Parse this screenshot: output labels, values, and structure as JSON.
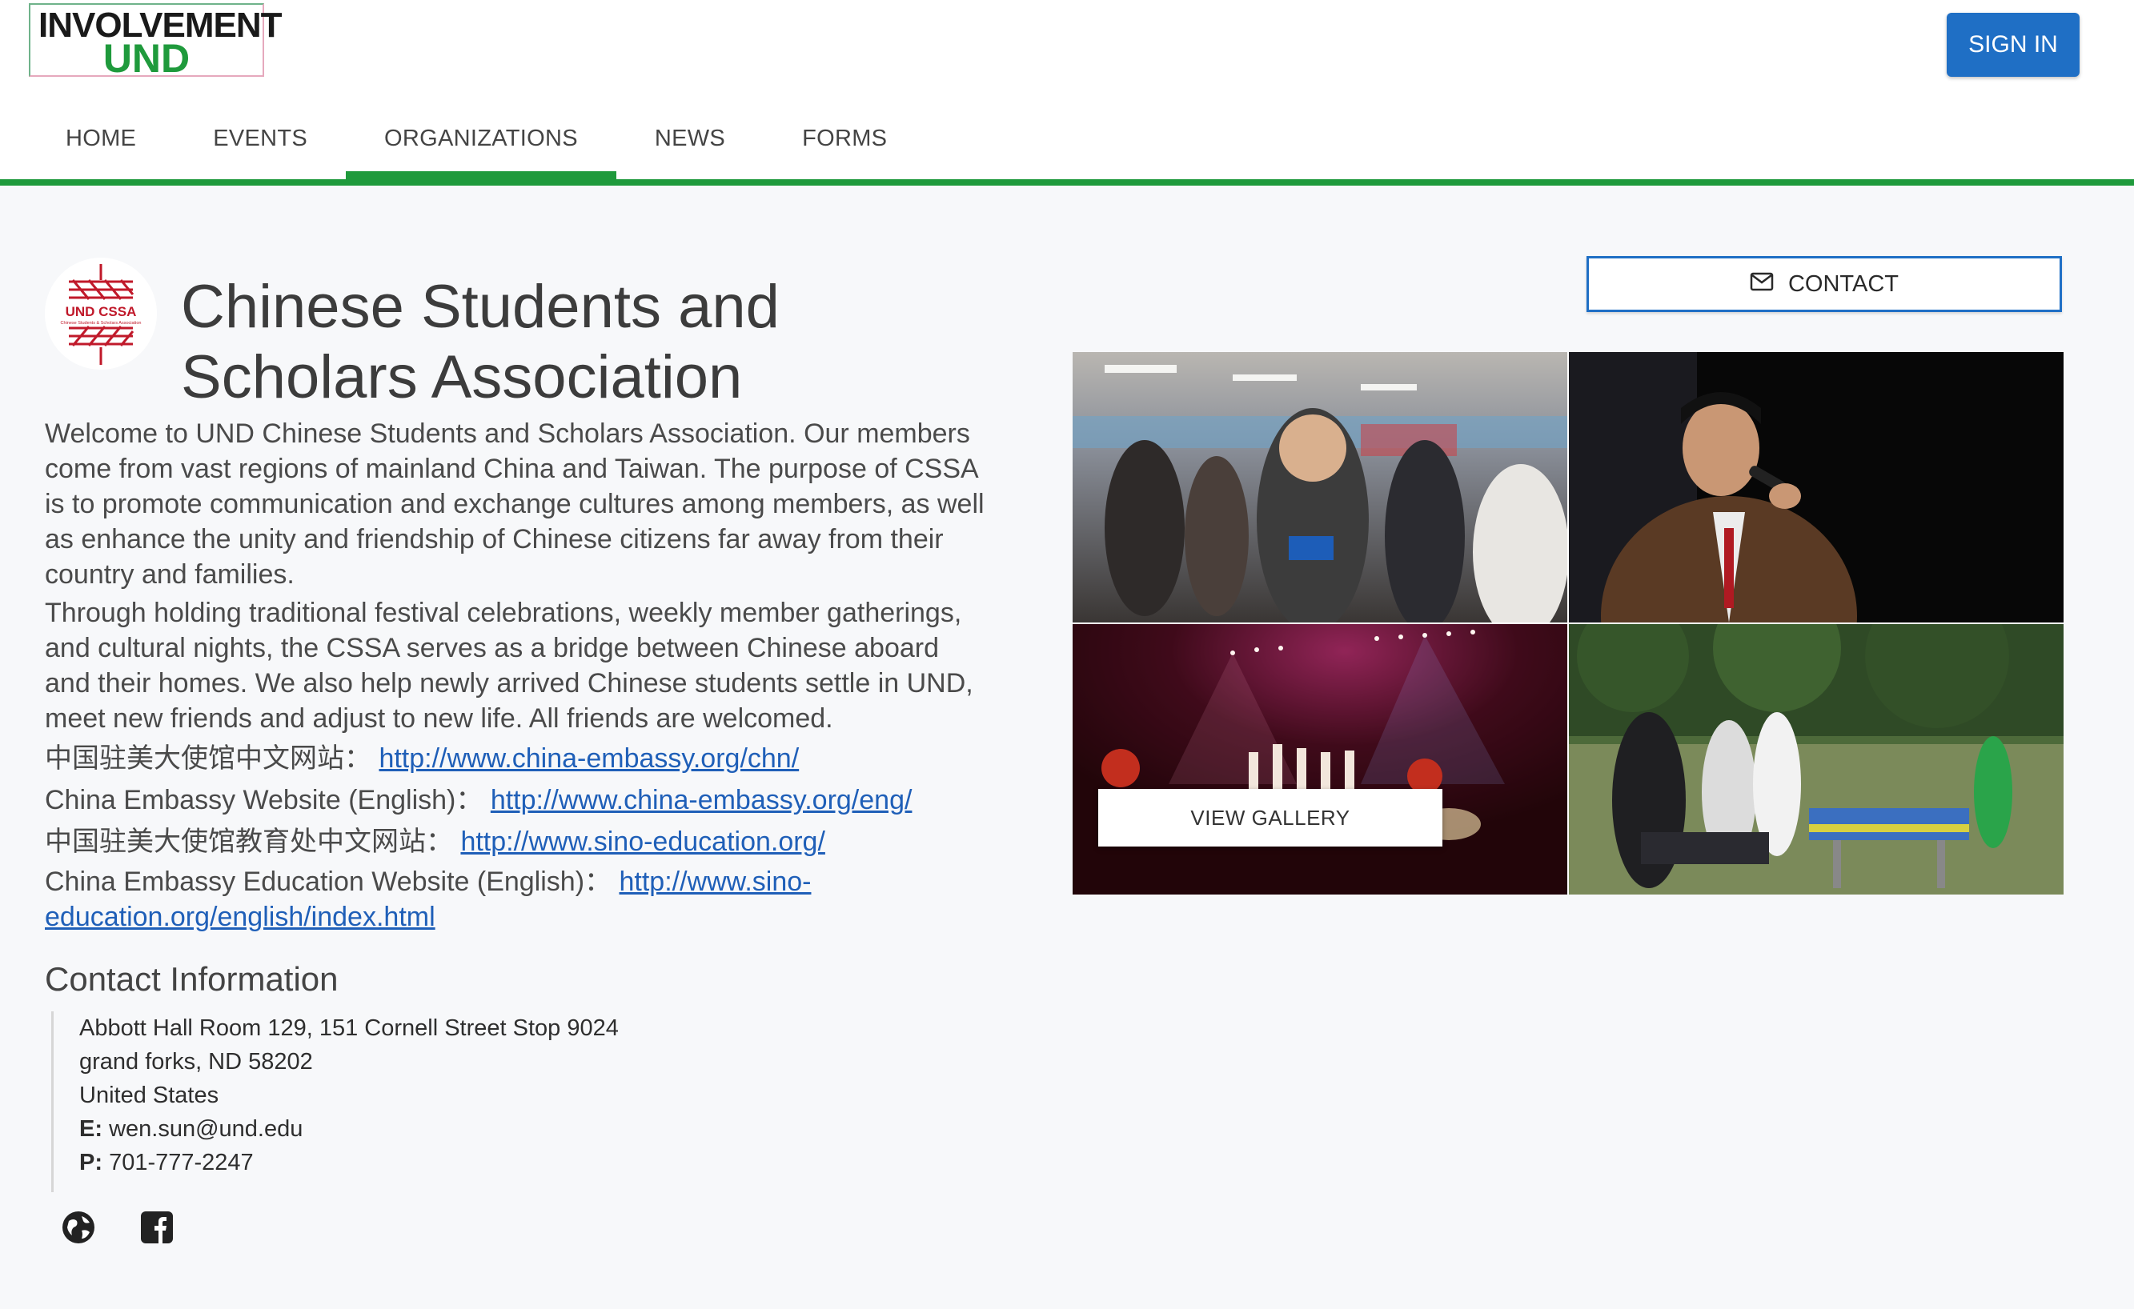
{
  "header": {
    "logo_line1": "INVOLVEMENT",
    "logo_line2": "UND",
    "signin_label": "SIGN IN"
  },
  "nav": {
    "tabs": [
      {
        "label": "HOME",
        "active": false
      },
      {
        "label": "EVENTS",
        "active": false
      },
      {
        "label": "ORGANIZATIONS",
        "active": true
      },
      {
        "label": "NEWS",
        "active": false
      },
      {
        "label": "FORMS",
        "active": false
      }
    ]
  },
  "colors": {
    "brand_green": "#1f9a3c",
    "primary_blue": "#1f6fc5",
    "link_blue": "#1f5fb8"
  },
  "organization": {
    "logo_text_1": "UND CSSA",
    "logo_text_2": "Chinese Students & Scholars Association",
    "name": "Chinese Students and Scholars Association",
    "description_p1": "Welcome to UND Chinese Students and Scholars Association. Our members come from vast regions of mainland China and Taiwan.  The purpose of CSSA is to promote communication and exchange cultures among members, as well as enhance the unity and friendship of Chinese citizens far away from their country and families.",
    "description_p2": "Through holding traditional festival celebrations, weekly member gatherings, and cultural nights, the CSSA serves as a bridge between Chinese aboard and their homes.  We also help newly arrived Chinese students settle in UND, meet new friends and adjust to new life.  All friends are welcomed.",
    "links": [
      {
        "label": "中国驻美大使馆中文网站：",
        "url": "http://www.china-embassy.org/chn/"
      },
      {
        "label": "China Embassy Website (English)：",
        "url": "http://www.china-embassy.org/eng/"
      },
      {
        "label": "中国驻美大使馆教育处中文网站：",
        "url": "http://www.sino-education.org/"
      },
      {
        "label": "China Embassy Education Website (English)：",
        "url": "http://www.sino-education.org/english/index.html"
      }
    ]
  },
  "contact": {
    "heading": "Contact Information",
    "address_line1": "Abbott Hall Room 129, 151 Cornell Street Stop 9024",
    "address_line2": "grand forks, ND 58202",
    "country": "United States",
    "email_label": "E:",
    "email": "wen.sun@und.edu",
    "phone_label": "P:",
    "phone": "701-777-2247",
    "button_label": "CONTACT",
    "social_icons": [
      "globe-icon",
      "facebook-icon"
    ]
  },
  "gallery": {
    "view_label": "VIEW GALLERY"
  }
}
